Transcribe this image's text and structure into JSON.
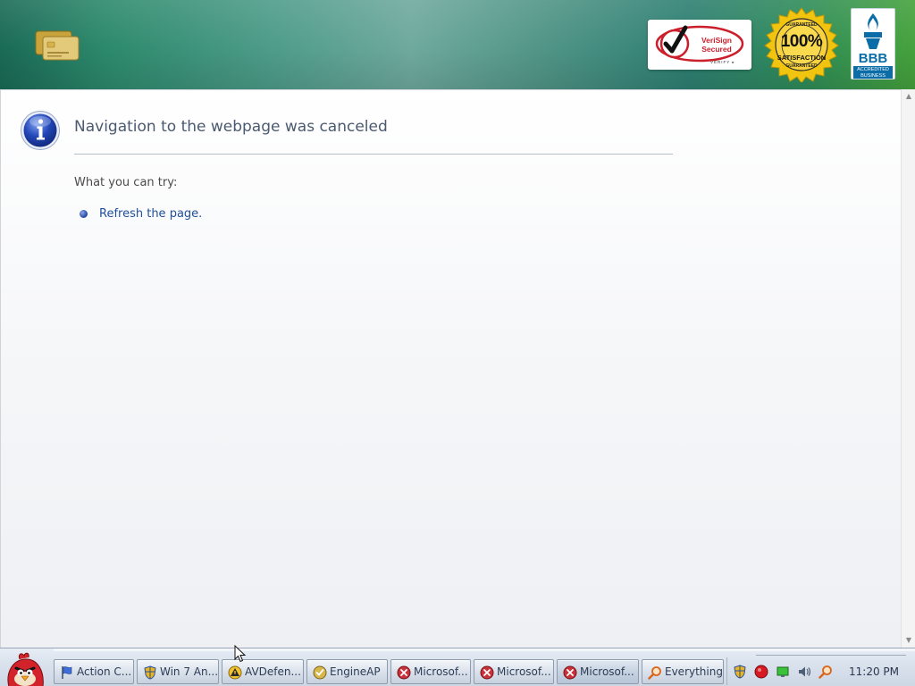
{
  "banner": {
    "verisign": {
      "line1": "VeriSign",
      "line2": "Secured",
      "verify": "VERIFY ▸"
    },
    "satisfaction": {
      "top": "GUARANTEED",
      "big": "100%",
      "small": "SATISFACTION",
      "bottom": "GUARANTEED"
    },
    "bbb": {
      "main": "BBB",
      "line1": "ACCREDITED",
      "line2": "BUSINESS"
    }
  },
  "page": {
    "title": "Navigation to the webpage was canceled",
    "try_label": "What you can try:",
    "suggestions": [
      {
        "label": "Refresh the page."
      }
    ]
  },
  "taskbar": {
    "buttons": [
      {
        "label": "Action C...",
        "icon": "flag-icon"
      },
      {
        "label": "Win 7 An...",
        "icon": "shield-icon"
      },
      {
        "label": "AVDefen...",
        "icon": "warning-shield-icon"
      },
      {
        "label": "EngineAP",
        "icon": "gold-shield-icon"
      },
      {
        "label": "Microsof...",
        "icon": "error-icon"
      },
      {
        "label": "Microsof...",
        "icon": "error-icon"
      },
      {
        "label": "Microsof...",
        "icon": "error-icon"
      },
      {
        "label": "Everything",
        "icon": "search-icon"
      }
    ],
    "active_button": 6,
    "tray_icons": [
      "shield-icon",
      "red-alert-icon",
      "network-icon",
      "volume-icon",
      "search-icon"
    ],
    "clock": "11:20 PM"
  },
  "colors": {
    "title_text": "#4a5a70",
    "link_text": "#1f4f9c",
    "banner_accent": "#2d8a6c",
    "error_red": "#c8323a"
  }
}
